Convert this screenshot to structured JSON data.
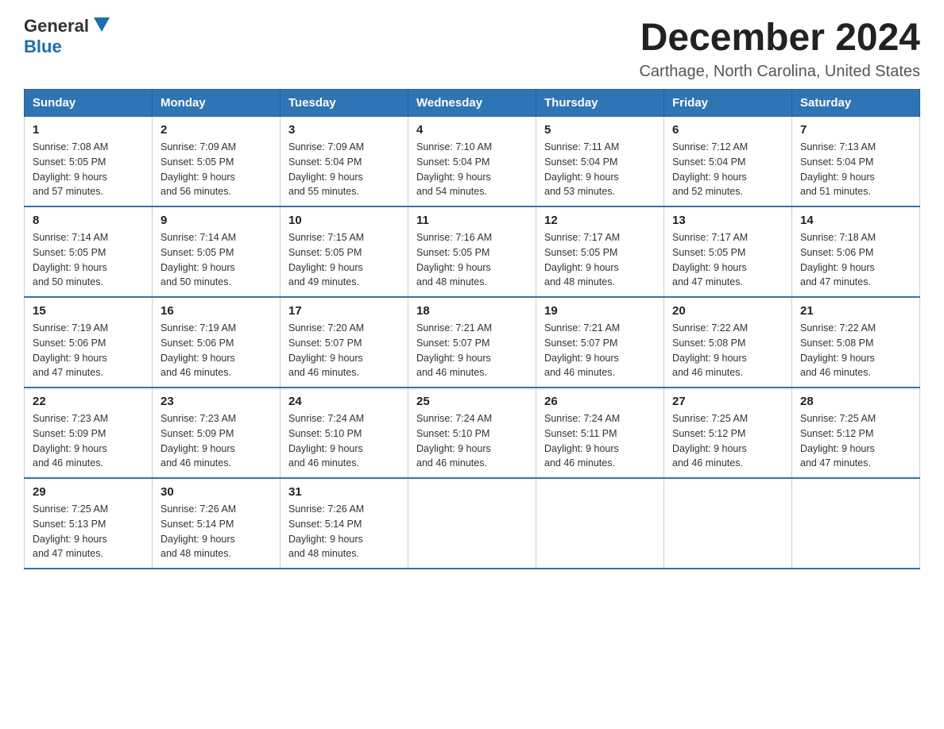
{
  "logo": {
    "general": "General",
    "blue": "Blue"
  },
  "header": {
    "month": "December 2024",
    "location": "Carthage, North Carolina, United States"
  },
  "days_of_week": [
    "Sunday",
    "Monday",
    "Tuesday",
    "Wednesday",
    "Thursday",
    "Friday",
    "Saturday"
  ],
  "weeks": [
    [
      {
        "day": "1",
        "sunrise": "7:08 AM",
        "sunset": "5:05 PM",
        "daylight": "9 hours and 57 minutes."
      },
      {
        "day": "2",
        "sunrise": "7:09 AM",
        "sunset": "5:05 PM",
        "daylight": "9 hours and 56 minutes."
      },
      {
        "day": "3",
        "sunrise": "7:09 AM",
        "sunset": "5:04 PM",
        "daylight": "9 hours and 55 minutes."
      },
      {
        "day": "4",
        "sunrise": "7:10 AM",
        "sunset": "5:04 PM",
        "daylight": "9 hours and 54 minutes."
      },
      {
        "day": "5",
        "sunrise": "7:11 AM",
        "sunset": "5:04 PM",
        "daylight": "9 hours and 53 minutes."
      },
      {
        "day": "6",
        "sunrise": "7:12 AM",
        "sunset": "5:04 PM",
        "daylight": "9 hours and 52 minutes."
      },
      {
        "day": "7",
        "sunrise": "7:13 AM",
        "sunset": "5:04 PM",
        "daylight": "9 hours and 51 minutes."
      }
    ],
    [
      {
        "day": "8",
        "sunrise": "7:14 AM",
        "sunset": "5:05 PM",
        "daylight": "9 hours and 50 minutes."
      },
      {
        "day": "9",
        "sunrise": "7:14 AM",
        "sunset": "5:05 PM",
        "daylight": "9 hours and 50 minutes."
      },
      {
        "day": "10",
        "sunrise": "7:15 AM",
        "sunset": "5:05 PM",
        "daylight": "9 hours and 49 minutes."
      },
      {
        "day": "11",
        "sunrise": "7:16 AM",
        "sunset": "5:05 PM",
        "daylight": "9 hours and 48 minutes."
      },
      {
        "day": "12",
        "sunrise": "7:17 AM",
        "sunset": "5:05 PM",
        "daylight": "9 hours and 48 minutes."
      },
      {
        "day": "13",
        "sunrise": "7:17 AM",
        "sunset": "5:05 PM",
        "daylight": "9 hours and 47 minutes."
      },
      {
        "day": "14",
        "sunrise": "7:18 AM",
        "sunset": "5:06 PM",
        "daylight": "9 hours and 47 minutes."
      }
    ],
    [
      {
        "day": "15",
        "sunrise": "7:19 AM",
        "sunset": "5:06 PM",
        "daylight": "9 hours and 47 minutes."
      },
      {
        "day": "16",
        "sunrise": "7:19 AM",
        "sunset": "5:06 PM",
        "daylight": "9 hours and 46 minutes."
      },
      {
        "day": "17",
        "sunrise": "7:20 AM",
        "sunset": "5:07 PM",
        "daylight": "9 hours and 46 minutes."
      },
      {
        "day": "18",
        "sunrise": "7:21 AM",
        "sunset": "5:07 PM",
        "daylight": "9 hours and 46 minutes."
      },
      {
        "day": "19",
        "sunrise": "7:21 AM",
        "sunset": "5:07 PM",
        "daylight": "9 hours and 46 minutes."
      },
      {
        "day": "20",
        "sunrise": "7:22 AM",
        "sunset": "5:08 PM",
        "daylight": "9 hours and 46 minutes."
      },
      {
        "day": "21",
        "sunrise": "7:22 AM",
        "sunset": "5:08 PM",
        "daylight": "9 hours and 46 minutes."
      }
    ],
    [
      {
        "day": "22",
        "sunrise": "7:23 AM",
        "sunset": "5:09 PM",
        "daylight": "9 hours and 46 minutes."
      },
      {
        "day": "23",
        "sunrise": "7:23 AM",
        "sunset": "5:09 PM",
        "daylight": "9 hours and 46 minutes."
      },
      {
        "day": "24",
        "sunrise": "7:24 AM",
        "sunset": "5:10 PM",
        "daylight": "9 hours and 46 minutes."
      },
      {
        "day": "25",
        "sunrise": "7:24 AM",
        "sunset": "5:10 PM",
        "daylight": "9 hours and 46 minutes."
      },
      {
        "day": "26",
        "sunrise": "7:24 AM",
        "sunset": "5:11 PM",
        "daylight": "9 hours and 46 minutes."
      },
      {
        "day": "27",
        "sunrise": "7:25 AM",
        "sunset": "5:12 PM",
        "daylight": "9 hours and 46 minutes."
      },
      {
        "day": "28",
        "sunrise": "7:25 AM",
        "sunset": "5:12 PM",
        "daylight": "9 hours and 47 minutes."
      }
    ],
    [
      {
        "day": "29",
        "sunrise": "7:25 AM",
        "sunset": "5:13 PM",
        "daylight": "9 hours and 47 minutes."
      },
      {
        "day": "30",
        "sunrise": "7:26 AM",
        "sunset": "5:14 PM",
        "daylight": "9 hours and 48 minutes."
      },
      {
        "day": "31",
        "sunrise": "7:26 AM",
        "sunset": "5:14 PM",
        "daylight": "9 hours and 48 minutes."
      },
      null,
      null,
      null,
      null
    ]
  ],
  "labels": {
    "sunrise": "Sunrise:",
    "sunset": "Sunset:",
    "daylight": "Daylight:"
  }
}
